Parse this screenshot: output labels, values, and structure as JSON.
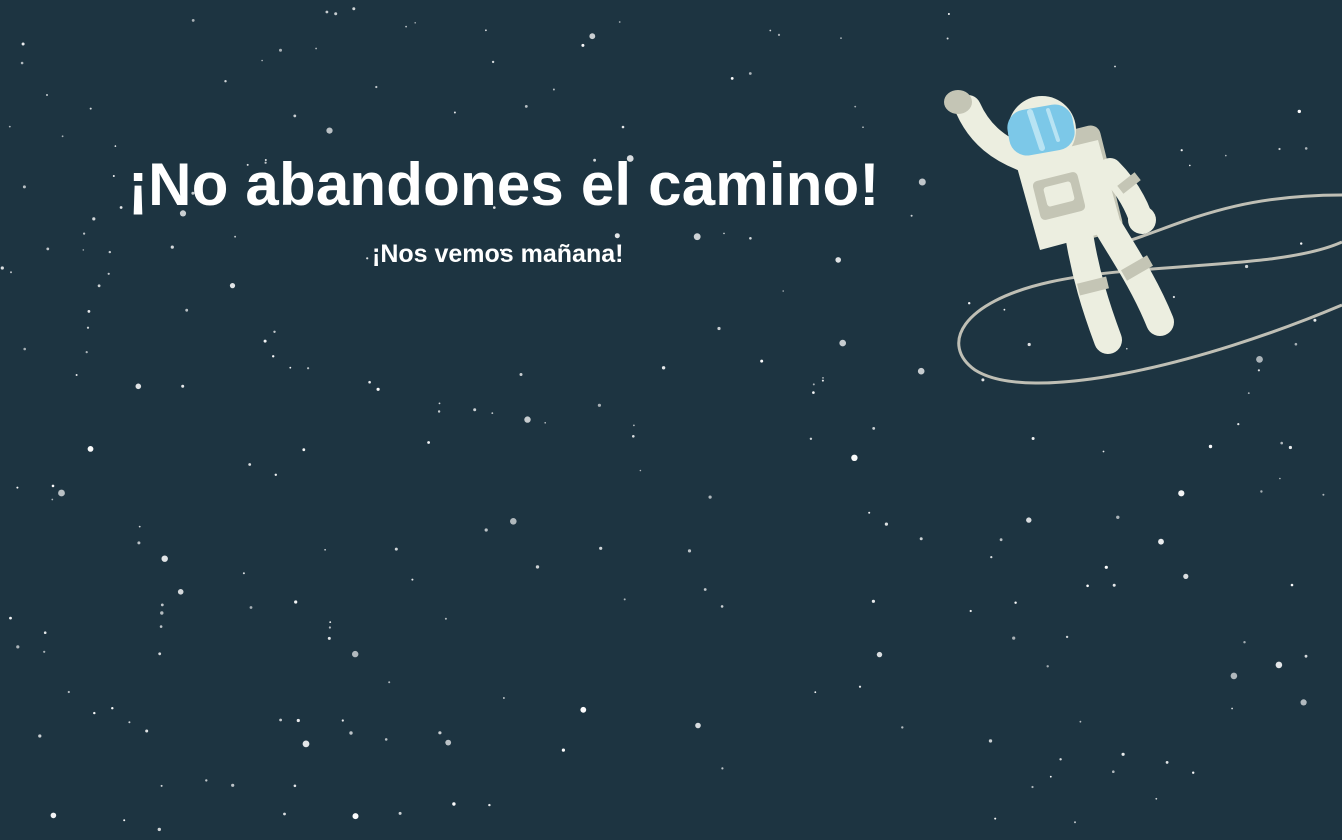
{
  "headline": "¡No abandones el camino!",
  "subline": "¡Nos vemos mañana!",
  "illustration": {
    "name": "astronaut-icon",
    "colors": {
      "background": "#1d3441",
      "star": "#ffffff",
      "suit": "#eceee0",
      "suit_shadow": "#c4c5b5",
      "visor": "#7cc8e8",
      "tether": "#bfbfb5"
    }
  }
}
